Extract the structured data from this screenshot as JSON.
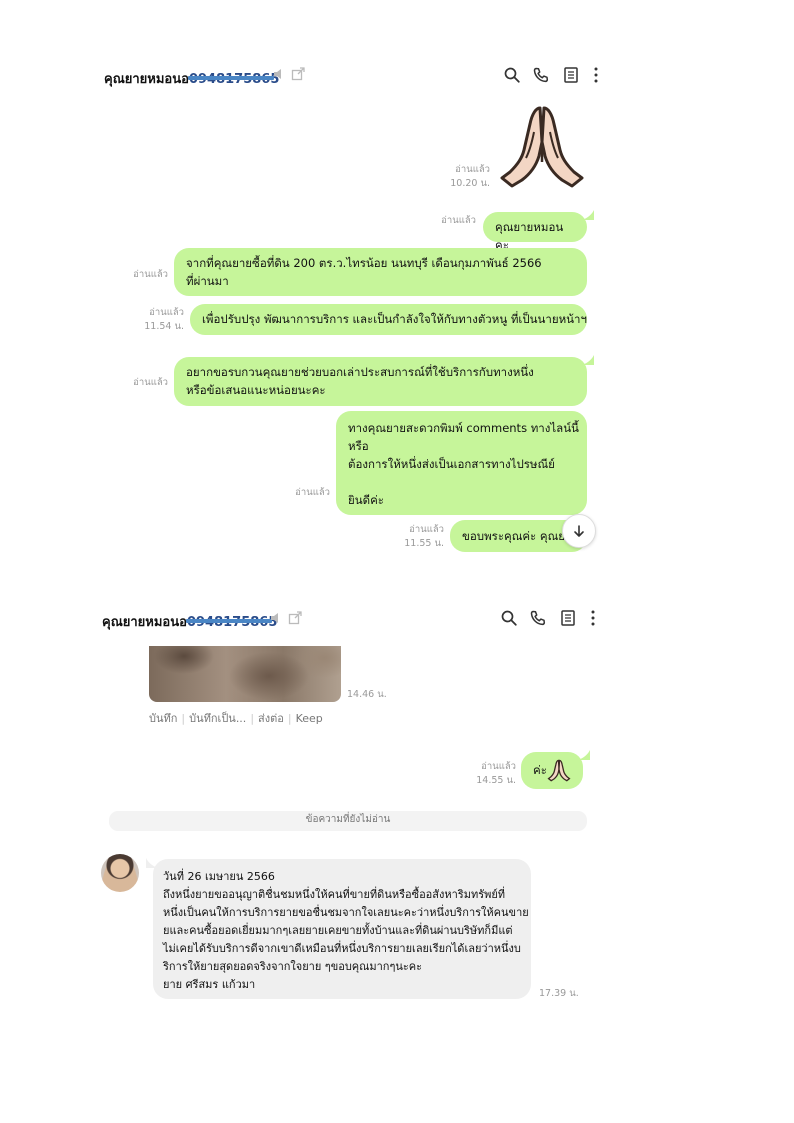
{
  "screen1": {
    "header": {
      "title": "คุณยายหมอนอ",
      "phone_partial": "0948175865",
      "icons": [
        "search-icon",
        "call-icon",
        "notes-icon",
        "more-icon"
      ]
    },
    "messages": [
      {
        "type": "sticker",
        "sticker": "praying-hands",
        "read": "อ่านแล้ว",
        "time": "10.20 น."
      },
      {
        "type": "text",
        "text": "คุณยายหมอนคะ",
        "read": "อ่านแล้ว",
        "time": ""
      },
      {
        "type": "text",
        "lines": [
          "จากที่คุณยายซื้อที่ดิน 200 ตร.ว.ไทรน้อย นนทบุรี เดือนกุมภาพันธ์ 2566",
          "ที่ผ่านมา"
        ],
        "read": "อ่านแล้ว",
        "time": ""
      },
      {
        "type": "text",
        "text": "เพื่อปรับปรุง พัฒนาการบริการ และเป็นกำลังใจให้กับทางตัวหนู ที่เป็นนายหน้าฯ",
        "read": "อ่านแล้ว",
        "time": "11.54 น."
      },
      {
        "type": "text",
        "lines": [
          "อยากขอรบกวนคุณยายช่วยบอกเล่าประสบการณ์ที่ใช้บริการกับทางหนึ่ง",
          "หรือข้อเสนอแนะหน่อยนะคะ"
        ],
        "read": "อ่านแล้ว",
        "time": ""
      },
      {
        "type": "text",
        "lines": [
          "ทางคุณยายสะดวกพิมพ์ comments ทางไลน์นี้",
          "หรือ",
          "ต้องการให้หนึ่งส่งเป็นเอกสารทางไปรษณีย์",
          "",
          "ยินดีค่ะ"
        ],
        "read": "อ่านแล้ว",
        "time": ""
      },
      {
        "type": "text",
        "text": "ขอบพระคุณค่ะ คุณยาย",
        "read": "อ่านแล้ว",
        "time": "11.55 น."
      }
    ]
  },
  "screen2": {
    "header": {
      "title": "คุณยายหมอนอ",
      "phone_partial": "0948175865"
    },
    "photo_message": {
      "time": "14.46 น.",
      "actions": [
        "บันทึก",
        "บันทึกเป็น...",
        "ส่งต่อ",
        "Keep"
      ]
    },
    "sent_message": {
      "text": "ค่ะ",
      "sticker": "praying-hands",
      "read": "อ่านแล้ว",
      "time": "14.55 น."
    },
    "unread_banner": "ข้อความที่ยังไม่อ่าน",
    "received_message": {
      "lines": [
        "วันที่  26  เมษายน 2566",
        "ถึงหนึ่งยายขออนุญาติชื่นชมหนึ่งให้คนที่ขายที่ดินหรือซื้ออสังหาริมทรัพย์ที่",
        "หนึ่งเป็นคนให้การบริการยายขอชื่นชมจากใจเลยนะคะว่าหนึ่งบริการให้คนขาย",
        "ยและคนซื้อยอดเยี่ยมมากๆเลยยายเคยขายทั้งบ้านและที่ดินผ่านบริษัทก็มีแต่",
        "ไม่เคยได้รับบริการดีจากเขาดีเหมือนที่หนึ่งบริการยายเลยเรียกได้เลยว่าหนึ่งบ",
        "ริการให้ยายสุดยอดจริงจากใจยาย ๆขอบคุณมากๆนะคะ",
        "ยาย  ศรีสมร  แก้วมา"
      ],
      "time": "17.39 น."
    }
  }
}
